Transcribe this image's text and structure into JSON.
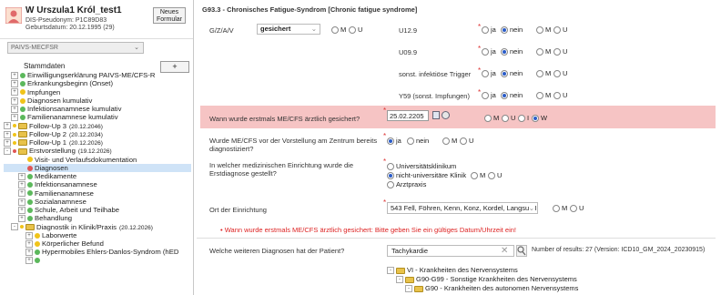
{
  "patient": {
    "name": "W Urszula1 Król_test1",
    "pseudonym": "DIS-Pseudonym: P1C89D83",
    "birthdate": "Geburtsdatum: 20.12.1995 (29)",
    "new_form_label_1": "Neues",
    "new_form_label_2": "Formular"
  },
  "study_select": "PAIVS-MECFSR",
  "stammdaten_label": "Stammdaten",
  "add_label": "+",
  "tree": [
    {
      "label": "Einwilligungserklärung PAIVS-ME/CFS-R",
      "indent": 1,
      "marker": "green",
      "expander": "+"
    },
    {
      "label": "Erkrankungsbeginn (Onset)",
      "indent": 1,
      "marker": "green",
      "expander": "+"
    },
    {
      "label": "Impfungen",
      "indent": 1,
      "marker": "yellow",
      "expander": "+"
    },
    {
      "label": "Diagnosen kumulativ",
      "indent": 1,
      "marker": "yellow",
      "expander": "+"
    },
    {
      "label": "Infektionsanamnese kumulativ",
      "indent": 1,
      "marker": "green",
      "expander": "+"
    },
    {
      "label": "Familienanamnese kumulativ",
      "indent": 1,
      "marker": "green",
      "expander": "+"
    },
    {
      "label": "Follow-Up 3",
      "date": "(20.12.2046)",
      "indent": 0,
      "marker": "folder-yellow",
      "expander": "+"
    },
    {
      "label": "Follow-Up 2",
      "date": "(20.12.2034)",
      "indent": 0,
      "marker": "folder-yellow",
      "expander": "+"
    },
    {
      "label": "Follow-Up 1",
      "date": "(20.12.2026)",
      "indent": 0,
      "marker": "folder-yellow",
      "expander": "+"
    },
    {
      "label": "Erstvorstellung",
      "date": "(19.12.2026)",
      "indent": 0,
      "marker": "folder-red",
      "expander": "-"
    },
    {
      "label": "Visit- und Verlaufsdokumentation",
      "indent": 2,
      "marker": "yellow",
      "expander": ""
    },
    {
      "label": "Diagnosen",
      "indent": 2,
      "marker": "red",
      "expander": "",
      "selected": true
    },
    {
      "label": "Medikamente",
      "indent": 2,
      "marker": "green",
      "expander": "+"
    },
    {
      "label": "Infektionsanamnese",
      "indent": 2,
      "marker": "green",
      "expander": "+"
    },
    {
      "label": "Familienanamnese",
      "indent": 2,
      "marker": "green",
      "expander": "+"
    },
    {
      "label": "Sozialanamnese",
      "indent": 2,
      "marker": "green",
      "expander": "+"
    },
    {
      "label": "Schule, Arbeit und Teilhabe",
      "indent": 2,
      "marker": "green",
      "expander": "+"
    },
    {
      "label": "Behandlung",
      "indent": 2,
      "marker": "green",
      "expander": "+"
    },
    {
      "label": "Diagnostik in Klinik/Praxis",
      "date": "(20.12.2026)",
      "indent": 1,
      "marker": "folder-yellow",
      "expander": "-"
    },
    {
      "label": "Laborwerte",
      "indent": 3,
      "marker": "yellow",
      "expander": "+"
    },
    {
      "label": "Körperlicher Befund",
      "indent": 3,
      "marker": "yellow",
      "expander": "+"
    },
    {
      "label": "Hypermobiles Ehlers-Danlos-Syndrom (hED",
      "indent": 3,
      "marker": "green",
      "expander": "+"
    },
    {
      "label": "",
      "indent": 3,
      "marker": "green",
      "expander": "+"
    }
  ],
  "form": {
    "title": "G93.3 - Chronisches Fatigue-Syndrom [Chronic fatigue syndrome]",
    "gzav_label": "G/Z/A/V",
    "gzav_value": "gesichert",
    "m_label": "M",
    "u_label": "U",
    "ja_label": "ja",
    "nein_label": "nein",
    "u129": "U12.9",
    "u099": "U09.9",
    "trigger": "sonst. infektiöse Trigger",
    "y59": "Y59 (sonst. Impfungen)",
    "q_first_diag": "Wann wurde erstmals ME/CFS ärztlich gesichert?",
    "first_diag_value": "25.02.2205",
    "i_label": "I",
    "w_label": "W",
    "q_before_center_1": "Wurde ME/CFS vor der Vorstellung am Zentrum bereits",
    "q_before_center_2": "diagnostiziert?",
    "q_institution_1": "In welcher medizinischen Einrichtung wurde die",
    "q_institution_2": "Erstdiagnose gestellt?",
    "inst_opt1": "Universitätsklinikum",
    "inst_opt2": "nicht-universitäre Klinik",
    "inst_opt3": "Arztpraxis",
    "q_place": "Ort der Einrichtung",
    "place_value": "543 Fell, Föhren, Kenn, Konz, Kordel, Langsur, I",
    "error": "Wann wurde erstmals ME/CFS ärztlich gesichert: Bitte geben Sie ein gültiges Datum/Uhrzeit ein!",
    "q_more_diag": "Welche weiteren Diagnosen hat der Patient?",
    "search_value": "Tachykardie",
    "results_text": "Number of results: 27 (Version: ICD10_GM_2024_20230915)",
    "icd_tree": [
      "VI - Krankheiten des Nervensystems",
      "G90-G99 - Sonstige Krankheiten des Nervensystems",
      "G90 - Krankheiten des autonomen Nervensystems"
    ]
  },
  "colors": {
    "highlight_row": "#f6c4c4",
    "selected_tree_item": "#cfe3f7",
    "error_text": "#d22222",
    "radio_selected": "#2a5cc8"
  }
}
